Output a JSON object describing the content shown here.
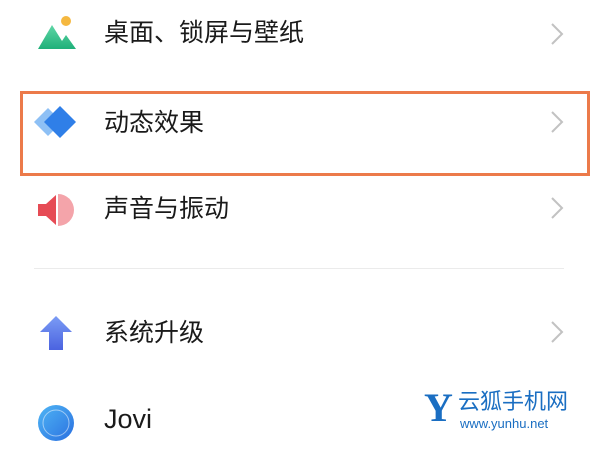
{
  "settings": {
    "items": [
      {
        "label": "桌面、锁屏与壁纸",
        "icon": "landscape-icon",
        "chevron": true
      },
      {
        "label": "动态效果",
        "icon": "diamond-icon",
        "chevron": true,
        "highlighted": true
      },
      {
        "label": "声音与振动",
        "icon": "speaker-icon",
        "chevron": true
      },
      {
        "label": "系统升级",
        "icon": "upgrade-arrow-icon",
        "chevron": true
      },
      {
        "label": "Jovi",
        "icon": "jovi-icon",
        "chevron": false
      }
    ]
  },
  "watermark": {
    "logo_letter": "Y",
    "name": "云狐手机网",
    "url": "www.yunhu.net"
  },
  "colors": {
    "highlight_border": "#ec7a4a",
    "watermark": "#1a6ec2",
    "chevron": "#c2c2c2"
  }
}
